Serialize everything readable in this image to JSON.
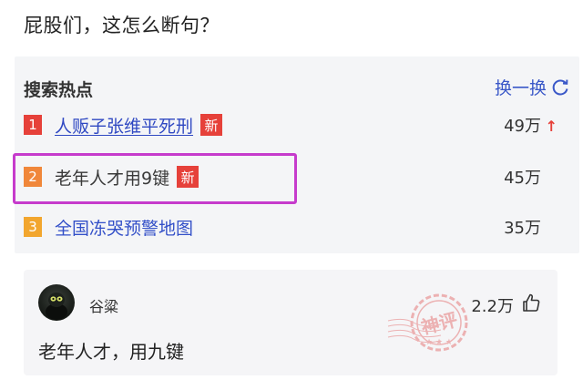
{
  "question": "屁股们，这怎么断句？",
  "hot_search": {
    "title": "搜索热点",
    "refresh_label": "换一换",
    "items": [
      {
        "rank": "1",
        "text": "人贩子张维平死刑",
        "badge": "新",
        "count": "49万",
        "trend": "up"
      },
      {
        "rank": "2",
        "text": "老年人才用9键",
        "badge": "新",
        "count": "45万"
      },
      {
        "rank": "3",
        "text": "全国冻哭预警地图",
        "count": "35万"
      }
    ]
  },
  "comment": {
    "author": "谷粱",
    "likes": "2.2万",
    "text": "老年人才，用九键",
    "stamp_text": "神评"
  },
  "colors": {
    "link": "#2f48c2",
    "highlight": "#c63bcc",
    "rank1": "#e6413a",
    "rank2": "#f0873a",
    "rank3": "#f2a62e",
    "stamp": "#e57a7a"
  }
}
